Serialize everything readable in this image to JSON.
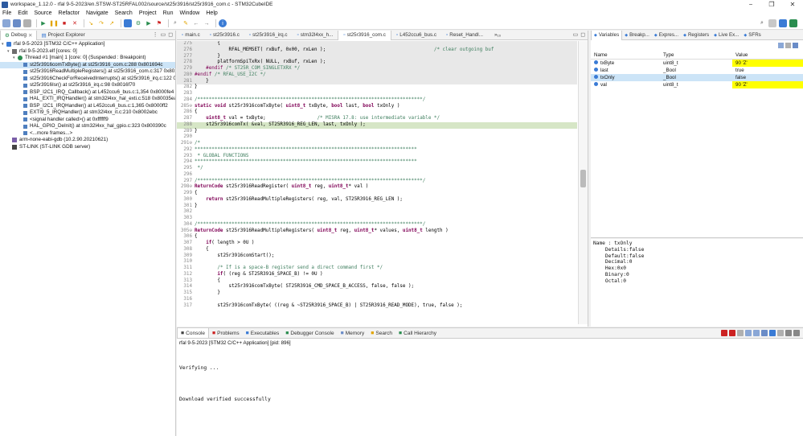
{
  "window": {
    "title": "workspace_1.12.0 - rfal 9-5-2023/en.STSW-ST25RFAL002/source/st25r3916/st25r3916_com.c - STM32CubeIDE",
    "controls": [
      "−",
      "❐",
      "✕"
    ]
  },
  "menu": [
    "File",
    "Edit",
    "Source",
    "Refactor",
    "Navigate",
    "Search",
    "Project",
    "Run",
    "Window",
    "Help"
  ],
  "left_panel": {
    "tabs": [
      "Debug",
      "Project Explorer"
    ],
    "tree": [
      {
        "text": "rfal 9-5-2023 [STM32 C/C++ Application]",
        "level": 0,
        "icon": "app",
        "twisty": "▾"
      },
      {
        "text": "rfal 9-5-2023.elf [cores: 0]",
        "level": 1,
        "icon": "elf",
        "twisty": "▾"
      },
      {
        "text": "Thread #1 [main] 1 [core: 0] (Suspended : Breakpoint)",
        "level": 2,
        "icon": "thread",
        "twisty": "▾"
      },
      {
        "text": "st25r3916comTxByte() at st25r3916_com.c:288 0x801694c",
        "level": 3,
        "icon": "frame",
        "selected": true
      },
      {
        "text": "st25r3916ReadMultipleRegisters() at st25r3916_com.c:317 0x801",
        "level": 3,
        "icon": "frame"
      },
      {
        "text": "st25r3916CheckForReceivedInterrupts() at st25r3916_irq.c:122 0x",
        "level": 3,
        "icon": "frame"
      },
      {
        "text": "st25r3916Isr() at st25r3916_irq.c:98 0x8016f70",
        "level": 3,
        "icon": "frame"
      },
      {
        "text": "BSP_I2C1_IRQ_Callback() at L452ccu6_bus.c:1,354 0x8000fe4",
        "level": 3,
        "icon": "frame"
      },
      {
        "text": "HAL_EXTI_IRQHandler() at stm32l4xx_hal_exti.c:518 0x80035ea",
        "level": 3,
        "icon": "frame"
      },
      {
        "text": "BSP_I2C1_IRQHandler() at L452ccu6_bus.c:1,365 0x8000ff2",
        "level": 3,
        "icon": "frame"
      },
      {
        "text": "EXTI9_5_IRQHandler() at stm32l4xx_it.c:210 0x8002ebc",
        "level": 3,
        "icon": "frame"
      },
      {
        "text": "<signal handler called>() at 0xffffff9",
        "level": 3,
        "icon": "frame"
      },
      {
        "text": "HAL_GPIO_DeInit() at stm32l4xx_hal_gpio.c:323 0x800390c",
        "level": 3,
        "icon": "frame"
      },
      {
        "text": "<...more frames...>",
        "level": 3,
        "icon": "frame"
      },
      {
        "text": "arm-none-eabi-gdb (10.2.90.20210621)",
        "level": 1,
        "icon": "gdb"
      },
      {
        "text": "ST-LINK (ST-LINK GDB server)",
        "level": 1,
        "icon": "stlink"
      }
    ]
  },
  "editor": {
    "tabs": [
      "main.c",
      "st25r3916.c",
      "st25r3916_irq.c",
      "stm32l4xx_h...",
      "st25r3916_com.c",
      "L452ccu6_bus.c",
      "Reset_Handl...",
      "»₁₀"
    ],
    "active_tab": 4,
    "lines": [
      {
        "n": "275",
        "t": "        {",
        "hl": true
      },
      {
        "n": "276",
        "t": "            RFAL_MEMSET( rxBuf, 0x00, rxLen );                                      /* clear outgoing buf",
        "hl": true
      },
      {
        "n": "277",
        "t": "        }",
        "hl": true
      },
      {
        "n": "278",
        "t": "        platformSpiTxRx( NULL, rxBuf, rxLen );",
        "hl": true
      },
      {
        "n": "279",
        "t": "    #endif /* ST25R_COM_SINGLETXRX */",
        "hl": true
      },
      {
        "n": "280",
        "t": "#endif /* RFAL_USE_I2C */",
        "hl": true
      },
      {
        "n": "281",
        "t": "    }",
        "hl": true
      },
      {
        "n": "282",
        "t": "}"
      },
      {
        "n": "283",
        "t": ""
      },
      {
        "n": "284",
        "t": "/*******************************************************************************/"
      },
      {
        "n": "285⊖",
        "t": "static void st25r3916comTxByte( uint8_t txByte, bool last, bool txOnly )"
      },
      {
        "n": "286",
        "t": "{"
      },
      {
        "n": "287",
        "t": "    uint8_t val = txByte;                  /* MISRA 17.8: use intermediate variable */"
      },
      {
        "n": "288",
        "t": "    st25r3916comTx( &val, ST25R3916_REG_LEN, last, txOnly );",
        "cur": true
      },
      {
        "n": "289",
        "t": "}"
      },
      {
        "n": "290",
        "t": ""
      },
      {
        "n": "291⊖",
        "t": "/*"
      },
      {
        "n": "292",
        "t": "******************************************************************************"
      },
      {
        "n": "293",
        "t": " * GLOBAL FUNCTIONS"
      },
      {
        "n": "294",
        "t": "******************************************************************************"
      },
      {
        "n": "295",
        "t": " */"
      },
      {
        "n": "296",
        "t": ""
      },
      {
        "n": "297",
        "t": "/*******************************************************************************/"
      },
      {
        "n": "298⊖",
        "t": "ReturnCode st25r3916ReadRegister( uint8_t reg, uint8_t* val )"
      },
      {
        "n": "299",
        "t": "{"
      },
      {
        "n": "300",
        "t": "    return st25r3916ReadMultipleRegisters( reg, val, ST25R3916_REG_LEN );"
      },
      {
        "n": "301",
        "t": "}"
      },
      {
        "n": "302",
        "t": ""
      },
      {
        "n": "303",
        "t": ""
      },
      {
        "n": "304",
        "t": "/*******************************************************************************/"
      },
      {
        "n": "305⊖",
        "t": "ReturnCode st25r3916ReadMultipleRegisters( uint8_t reg, uint8_t* values, uint8_t length )"
      },
      {
        "n": "306",
        "t": "{"
      },
      {
        "n": "307",
        "t": "    if( length > 0U )"
      },
      {
        "n": "308",
        "t": "    {"
      },
      {
        "n": "309",
        "t": "        st25r3916comStart();"
      },
      {
        "n": "310",
        "t": ""
      },
      {
        "n": "311",
        "t": "        /* If is a space-B register send a direct command first */"
      },
      {
        "n": "312",
        "t": "        if( (reg & ST25R3916_SPACE_B) != 0U )"
      },
      {
        "n": "313",
        "t": "        {"
      },
      {
        "n": "314",
        "t": "            st25r3916comTxByte( ST25R3916_CMD_SPACE_B_ACCESS, false, false );"
      },
      {
        "n": "315",
        "t": "        }"
      },
      {
        "n": "316",
        "t": ""
      },
      {
        "n": "317",
        "t": "        st25r3916comTxByte( ((reg & ~ST25R3916_SPACE_B) | ST25R3916_READ_MODE), true, false );"
      }
    ]
  },
  "variables": {
    "tabs": [
      "Variables",
      "Breakp...",
      "Expres...",
      "Registers",
      "Live Ex...",
      "SFRs"
    ],
    "columns": [
      "Name",
      "Type",
      "Value"
    ],
    "rows": [
      {
        "name": "txByte",
        "type": "uint8_t",
        "value": "90 'Z'",
        "changed": true
      },
      {
        "name": "last",
        "type": "_Bool",
        "value": "true"
      },
      {
        "name": "txOnly",
        "type": "_Bool",
        "value": "false",
        "selected": true
      },
      {
        "name": "val",
        "type": "uint8_t",
        "value": "90 'Z'",
        "changed": true
      }
    ],
    "details": [
      "Name : txOnly",
      "    Details:false",
      "    Default:false",
      "    Decimal:0",
      "    Hex:0x0",
      "    Binary:0",
      "    Octal:0"
    ]
  },
  "console": {
    "tabs": [
      "Console",
      "Problems",
      "Executables",
      "Debugger Console",
      "Memory",
      "Search",
      "Call Hierarchy"
    ],
    "subtitle": "rfal 9-5-2023 [STM32 C/C++ Application] [pid: 896]",
    "output": [
      "",
      "",
      "",
      "Verifying ...",
      "",
      "",
      "",
      "",
      "Download verified successfully"
    ]
  }
}
